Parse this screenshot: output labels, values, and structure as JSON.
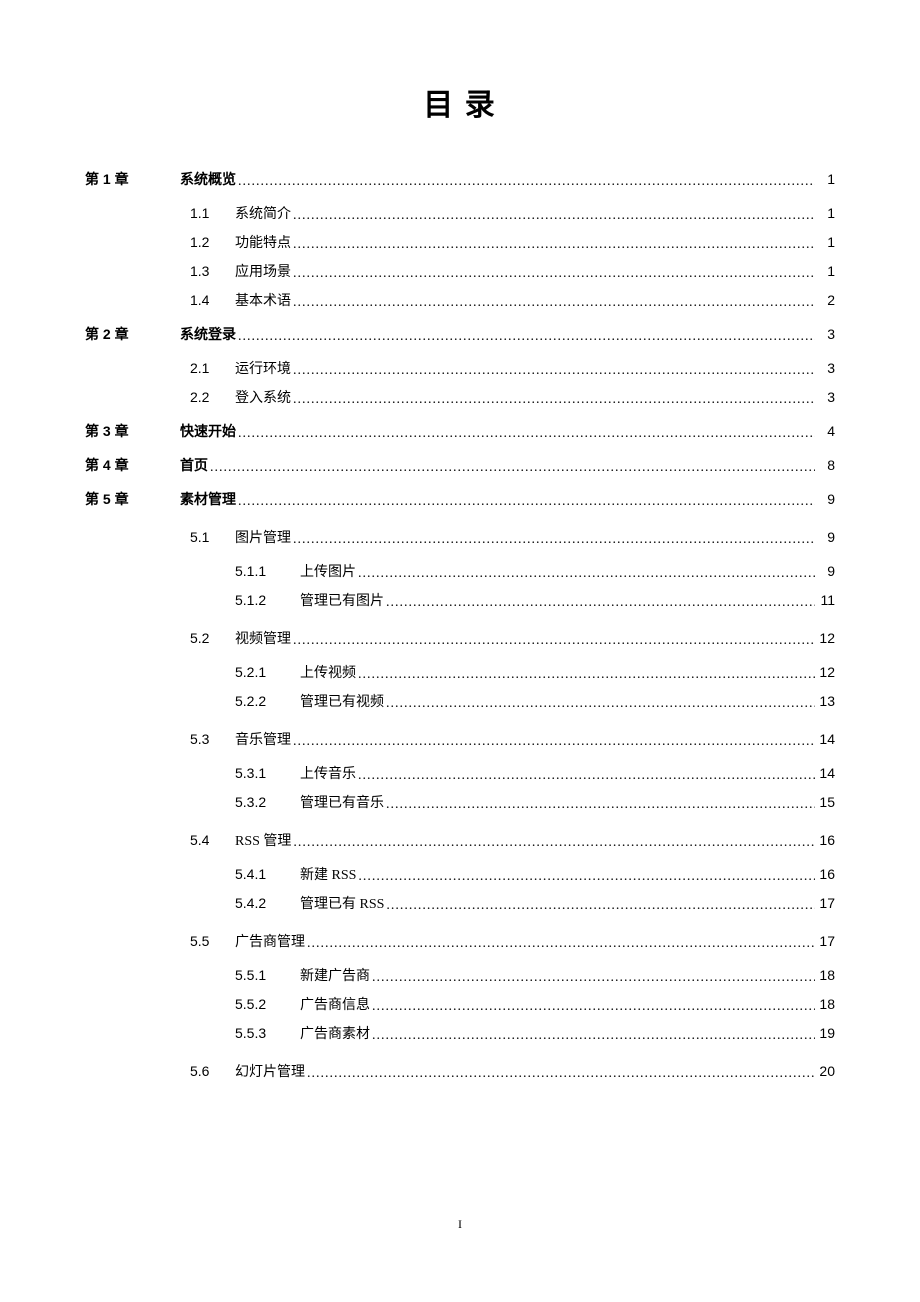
{
  "title": "目 录",
  "footer_page": "I",
  "chapters": [
    {
      "num": "第 1 章",
      "title": "系统概览",
      "page": "1",
      "subs": [
        {
          "num": "1.1",
          "title": "系统简介",
          "page": "1",
          "subs": []
        },
        {
          "num": "1.2",
          "title": "功能特点",
          "page": "1",
          "subs": []
        },
        {
          "num": "1.3",
          "title": "应用场景",
          "page": "1",
          "subs": []
        },
        {
          "num": "1.4",
          "title": "基本术语",
          "page": "2",
          "subs": []
        }
      ]
    },
    {
      "num": "第 2 章",
      "title": "系统登录",
      "page": "3",
      "subs": [
        {
          "num": "2.1",
          "title": "运行环境",
          "page": "3",
          "subs": []
        },
        {
          "num": "2.2",
          "title": "登入系统",
          "page": "3",
          "subs": []
        }
      ]
    },
    {
      "num": "第 3 章",
      "title": "快速开始",
      "page": "4",
      "subs": []
    },
    {
      "num": "第 4 章",
      "title": "首页",
      "page": "8",
      "subs": []
    },
    {
      "num": "第 5 章",
      "title": "素材管理",
      "page": "9",
      "subs": [
        {
          "num": "5.1",
          "title": "图片管理",
          "page": "9",
          "subs": [
            {
              "num": "5.1.1",
              "title": "上传图片",
              "page": "9"
            },
            {
              "num": "5.1.2",
              "title": "管理已有图片",
              "page": "11"
            }
          ]
        },
        {
          "num": "5.2",
          "title": "视频管理",
          "page": "12",
          "subs": [
            {
              "num": "5.2.1",
              "title": "上传视频",
              "page": "12"
            },
            {
              "num": "5.2.2",
              "title": "管理已有视频",
              "page": "13"
            }
          ]
        },
        {
          "num": "5.3",
          "title": "音乐管理",
          "page": "14",
          "subs": [
            {
              "num": "5.3.1",
              "title": "上传音乐",
              "page": "14"
            },
            {
              "num": "5.3.2",
              "title": "管理已有音乐",
              "page": "15"
            }
          ]
        },
        {
          "num": "5.4",
          "title": "RSS 管理",
          "page": "16",
          "subs": [
            {
              "num": "5.4.1",
              "title": "新建 RSS",
              "page": "16"
            },
            {
              "num": "5.4.2",
              "title": "管理已有 RSS",
              "page": "17"
            }
          ]
        },
        {
          "num": "5.5",
          "title": "广告商管理",
          "page": "17",
          "subs": [
            {
              "num": "5.5.1",
              "title": "新建广告商",
              "page": "18"
            },
            {
              "num": "5.5.2",
              "title": "广告商信息",
              "page": "18"
            },
            {
              "num": "5.5.3",
              "title": "广告商素材",
              "page": "19"
            }
          ]
        },
        {
          "num": "5.6",
          "title": "幻灯片管理",
          "page": "20",
          "subs": []
        }
      ]
    }
  ]
}
